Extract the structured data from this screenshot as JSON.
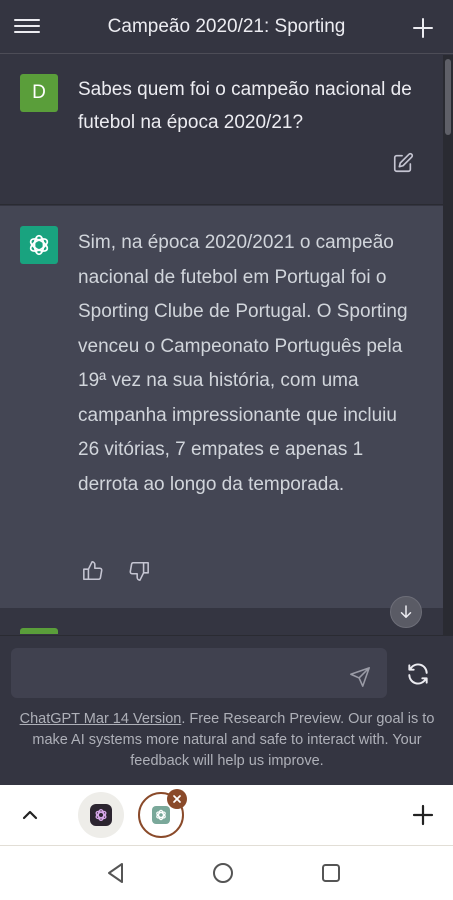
{
  "header": {
    "title": "Campeão 2020/21: Sporting",
    "menu_icon": "hamburger-menu-icon",
    "new_chat_icon": "plus-icon"
  },
  "conversation": {
    "user_message": {
      "avatar_letter": "D",
      "avatar_color": "#5a9e3a",
      "text": "Sabes quem foi o campeão nacional de futebol na época 2020/21?",
      "edit_icon": "edit-icon"
    },
    "assistant_message": {
      "avatar_color": "#19a37f",
      "text": "Sim, na época 2020/2021 o campeão nacional de futebol em Portugal foi o Sporting Clube de Portugal. O Sporting venceu o Campeonato Português pela 19ª vez na sua história, com uma campanha impressionante que incluiu 26 vitórias, 7 empates e apenas 1 derrota ao longo da temporada.",
      "thumbs_up_icon": "thumbs-up-icon",
      "thumbs_down_icon": "thumbs-down-icon"
    }
  },
  "composer": {
    "placeholder": "",
    "send_icon": "send-icon",
    "regenerate_icon": "refresh-icon"
  },
  "footer": {
    "version_link": "ChatGPT Mar 14 Version",
    "disclaimer": ". Free Research Preview. Our goal is to make AI systems more natural and safe to interact with. Your feedback will help us improve."
  },
  "browser_tabs": {
    "tabs": [
      {
        "icon": "app-icon",
        "active": false
      },
      {
        "icon": "chatgpt-icon",
        "active": true
      }
    ],
    "accent_color": "#8a4a2a"
  },
  "colors": {
    "background": "#343541",
    "assistant_background": "#444654",
    "composer_background": "#40414f"
  }
}
